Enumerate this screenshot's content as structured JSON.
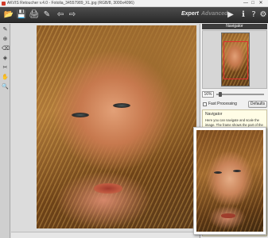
{
  "window": {
    "title": "AKVIS Retoucher v.4.0 - Fotolia_34557989_XL.jpg (RGB/8, 3000x4096)"
  },
  "titlebar_controls": {
    "minimize": "—",
    "maximize": "□",
    "close": "✕"
  },
  "toolbar": {
    "icons": [
      "open-icon",
      "save-icon",
      "print-icon",
      "brush-icon",
      "undo-icon",
      "redo-icon",
      "run-icon",
      "info-icon",
      "help-icon",
      "settings-icon"
    ],
    "mode_expert": "Expert",
    "mode_advanced": "Advanced"
  },
  "left_tools": [
    "brush-tool-icon",
    "stamp-tool-icon",
    "eraser-tool-icon",
    "fill-tool-icon",
    "scissors-tool-icon",
    "hand-tool-icon",
    "zoom-tool-icon"
  ],
  "panel": {
    "navigator_header": "Navigator",
    "zoom_value": "16%",
    "fast_processing_label": "Fast Processing",
    "defaults_label": "Defaults",
    "help_title": "Navigator",
    "help_text": "Here you can navigate and scale the image. The frame shows the part of the image that is now visible in the Image Window. Drag the frame to make other part of the image visible. Use the slider or the buttons + and – to scale the image. The pull-down menu shows some frequently used coefficients."
  },
  "colors": {
    "toolbar_bg": "#3a3a3a",
    "nav_frame": "#e03030",
    "help_bg": "#fffde6"
  }
}
